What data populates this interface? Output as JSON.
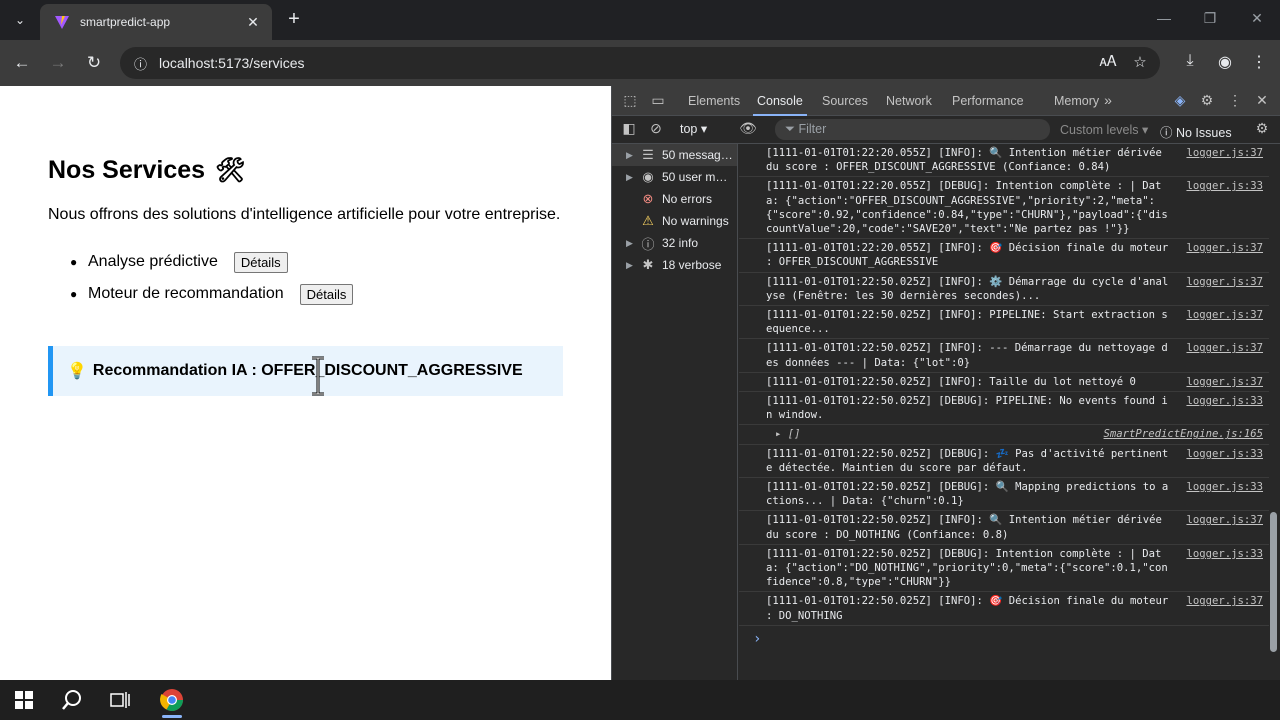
{
  "browser": {
    "tab_title": "smartpredict-app",
    "url": "localhost:5173/services"
  },
  "page": {
    "title": "Nos Services",
    "title_icon": "🛠",
    "intro": "Nous offrons des solutions d'intelligence artificielle pour votre entreprise.",
    "services": [
      {
        "label": "Analyse prédictive",
        "button": "Détails"
      },
      {
        "label": "Moteur de recommandation",
        "button": "Détails"
      }
    ],
    "recommendation": "Recommandation IA : OFFER_DISCOUNT_AGGRESSIVE",
    "recommendation_icon": "💡"
  },
  "devtools": {
    "tabs": [
      "Elements",
      "Console",
      "Sources",
      "Network",
      "Performance",
      "Memory"
    ],
    "active_tab": "Console",
    "context": "top",
    "filter_placeholder": "Filter",
    "levels": "Custom levels",
    "issues": "No Issues",
    "sidebar": [
      {
        "label": "50 messag…",
        "icon": "list-icon"
      },
      {
        "label": "50 user m…",
        "icon": "user-icon"
      },
      {
        "label": "No errors",
        "icon": "error-icon"
      },
      {
        "label": "No warnings",
        "icon": "warning-icon"
      },
      {
        "label": "32 info",
        "icon": "info-icon"
      },
      {
        "label": "18 verbose",
        "icon": "bug-icon"
      }
    ],
    "logs": [
      {
        "text": "[1111-01-01T01:22:20.055Z] [INFO]: 🔍 Intention métier dérivée du score : OFFER_DISCOUNT_AGGRESSIVE (Confiance: 0.84)",
        "src": "logger.js:37"
      },
      {
        "text": "[1111-01-01T01:22:20.055Z] [DEBUG]: Intention complète : | Data: {\"action\":\"OFFER_DISCOUNT_AGGRESSIVE\",\"priority\":2,\"meta\":{\"score\":0.92,\"confidence\":0.84,\"type\":\"CHURN\"},\"payload\":{\"discountValue\":20,\"code\":\"SAVE20\",\"text\":\"Ne partez pas !\"}}",
        "src": "logger.js:33"
      },
      {
        "text": "[1111-01-01T01:22:20.055Z] [INFO]: 🎯 Décision finale du moteur : OFFER_DISCOUNT_AGGRESSIVE",
        "src": "logger.js:37"
      },
      {
        "text": "[1111-01-01T01:22:50.025Z] [INFO]: ⚙️ Démarrage du cycle d'analyse (Fenêtre: les 30 dernières secondes)...",
        "src": "logger.js:37"
      },
      {
        "text": "[1111-01-01T01:22:50.025Z] [INFO]: PIPELINE: Start extraction sequence...",
        "src": "logger.js:37"
      },
      {
        "text": "[1111-01-01T01:22:50.025Z] [INFO]: --- Démarrage du nettoyage des données --- | Data: {\"lot\":0}",
        "src": "logger.js:37"
      },
      {
        "text": "[1111-01-01T01:22:50.025Z] [INFO]: Taille du lot nettoyé 0",
        "src": "logger.js:37"
      },
      {
        "text": "[1111-01-01T01:22:50.025Z] [DEBUG]: PIPELINE: No events found in window.",
        "src": "logger.js:33"
      },
      {
        "text": "[1111-01-01T01:22:50.025Z] [DEBUG]: 💤 Pas d'activité pertinente détectée. Maintien du score par défaut.",
        "src": "logger.js:33"
      },
      {
        "text": "[1111-01-01T01:22:50.025Z] [DEBUG]: 🔍 Mapping predictions to actions... | Data: {\"churn\":0.1}",
        "src": "logger.js:33"
      },
      {
        "text": "[1111-01-01T01:22:50.025Z] [INFO]: 🔍 Intention métier dérivée du score : DO_NOTHING (Confiance: 0.8)",
        "src": "logger.js:37"
      },
      {
        "text": "[1111-01-01T01:22:50.025Z] [DEBUG]: Intention complète : | Data: {\"action\":\"DO_NOTHING\",\"priority\":0,\"meta\":{\"score\":0.1,\"confidence\":0.8,\"type\":\"CHURN\"}}",
        "src": "logger.js:33"
      },
      {
        "text": "[1111-01-01T01:22:50.025Z] [INFO]: 🎯 Décision finale du moteur : DO_NOTHING",
        "src": "logger.js:37"
      }
    ],
    "object_log": {
      "text": "▸ []",
      "src": "SmartPredictEngine.js:165"
    }
  }
}
